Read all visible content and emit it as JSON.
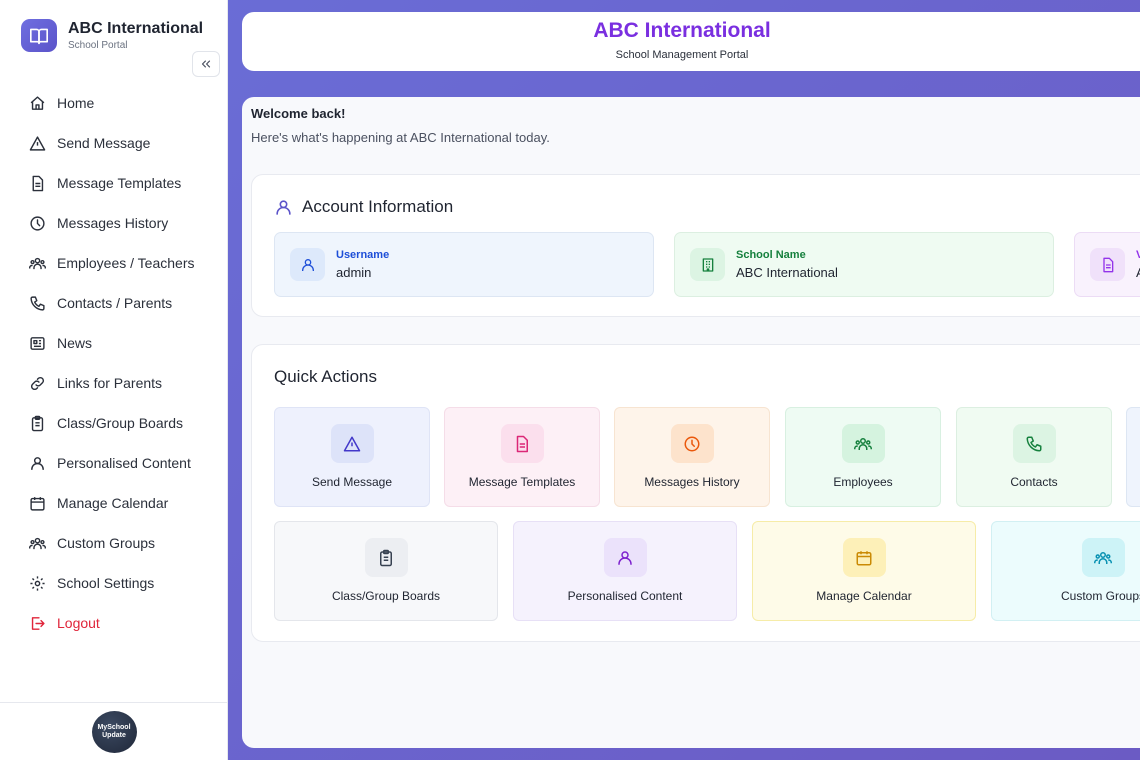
{
  "sidebar": {
    "brand_title": "ABC International",
    "brand_sub": "School Portal",
    "items": [
      {
        "label": "Home",
        "icon": "home-icon"
      },
      {
        "label": "Send Message",
        "icon": "send-icon"
      },
      {
        "label": "Message Templates",
        "icon": "document-icon"
      },
      {
        "label": "Messages History",
        "icon": "clock-icon"
      },
      {
        "label": "Employees / Teachers",
        "icon": "users-icon"
      },
      {
        "label": "Contacts / Parents",
        "icon": "phone-icon"
      },
      {
        "label": "News",
        "icon": "newspaper-icon"
      },
      {
        "label": "Links for Parents",
        "icon": "link-icon"
      },
      {
        "label": "Class/Group Boards",
        "icon": "clipboard-icon"
      },
      {
        "label": "Personalised Content",
        "icon": "user-icon"
      },
      {
        "label": "Manage Calendar",
        "icon": "calendar-icon"
      },
      {
        "label": "Custom Groups",
        "icon": "users-icon"
      },
      {
        "label": "School Settings",
        "icon": "gear-icon"
      },
      {
        "label": "Logout",
        "icon": "logout-icon"
      }
    ],
    "footer_logo_text": "MySchool Update"
  },
  "header": {
    "title": "ABC International",
    "subtitle": "School Management Portal"
  },
  "welcome": {
    "title": "Welcome back!",
    "subtitle": "Here's what's happening at ABC International today."
  },
  "account": {
    "title": "Account Information",
    "username_label": "Username",
    "username_value": "admin",
    "school_label": "School Name",
    "school_value": "ABC International",
    "third_label": "V",
    "third_value": "A"
  },
  "quick_actions": {
    "title": "Quick Actions",
    "row1": [
      "Send Message",
      "Message Templates",
      "Messages History",
      "Employees",
      "Contacts"
    ],
    "row2": [
      "Class/Group Boards",
      "Personalised Content",
      "Manage Calendar",
      "Custom Groups"
    ]
  },
  "colors": {
    "accent": "#7a2fe0",
    "logout": "#e0253a",
    "username_label": "#1d4ed8",
    "school_label": "#15803d",
    "third_label": "#9333ea"
  }
}
